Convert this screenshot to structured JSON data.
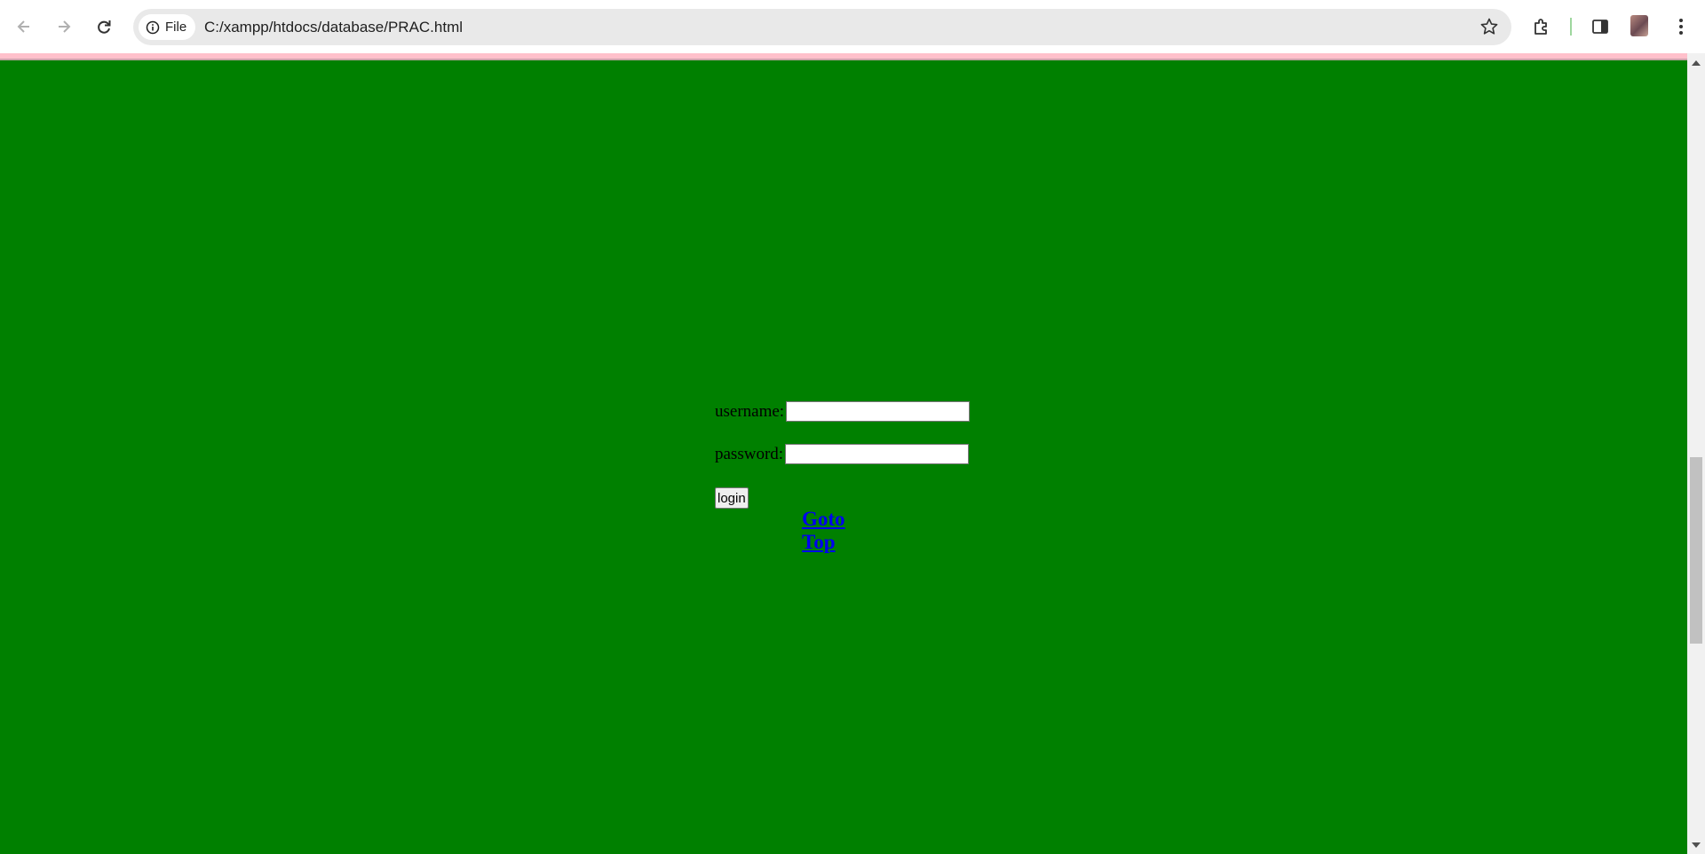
{
  "browser": {
    "chip_label": "File",
    "url": "C:/xampp/htdocs/database/PRAC.html"
  },
  "colors": {
    "page_background": "#008000",
    "top_strip": "#ffc0cb",
    "link": "#0000ee"
  },
  "form": {
    "username_label": "username:",
    "username_value": "",
    "password_label": "password:",
    "password_value": "",
    "login_label": "login"
  },
  "link": {
    "goto_top": "Goto Top"
  }
}
